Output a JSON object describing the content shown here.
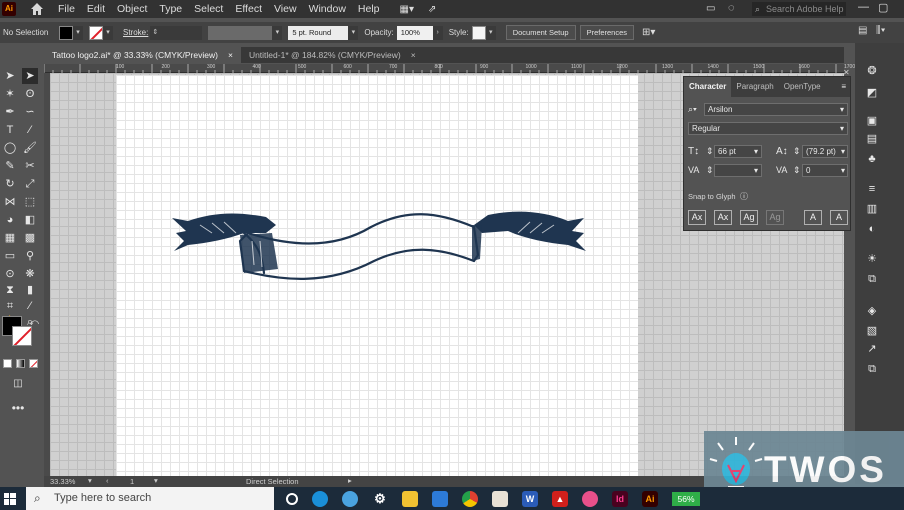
{
  "app": {
    "logo": "Ai",
    "menus": [
      "File",
      "Edit",
      "Object",
      "Type",
      "Select",
      "Effect",
      "View",
      "Window",
      "Help"
    ],
    "search_placeholder": "Search Adobe Help"
  },
  "control_bar": {
    "selection_label": "No Selection",
    "stroke_label": "Stroke:",
    "brush_value": "5 pt. Round",
    "opacity_label": "Opacity:",
    "opacity_value": "100%",
    "style_label": "Style:",
    "document_setup": "Document Setup",
    "preferences": "Preferences"
  },
  "document_tabs": [
    {
      "label": "Tattoo logo2.ai* @ 33.33% (CMYK/Preview)",
      "close": "×",
      "active": true
    },
    {
      "label": "Untitled-1* @ 184.82% (CMYK/Preview)",
      "close": "×",
      "active": false
    }
  ],
  "ruler_ticks": [
    "100",
    "200",
    "300",
    "400",
    "500",
    "600",
    "700",
    "800",
    "900",
    "1000",
    "1100",
    "1200",
    "1300",
    "1400",
    "1500",
    "1600",
    "1700"
  ],
  "status_bar": {
    "zoom": "33.33%",
    "artboard_number": "1",
    "tool_name": "Direct Selection"
  },
  "character_panel": {
    "tabs": [
      "Character",
      "Paragraph",
      "OpenType"
    ],
    "font_family": "Arsilon",
    "font_style": "Regular",
    "font_size": "66 pt",
    "leading": "(79.2 pt)",
    "tracking": "0",
    "snap_to_glyph": "Snap to Glyph",
    "glyph_buttons": [
      "Ax",
      "Ax",
      "Ag",
      "Ag",
      "A",
      "A"
    ]
  },
  "taskbar": {
    "search_placeholder": "Type here to search",
    "battery": "56%",
    "apps": [
      "Ai",
      "Id",
      "W"
    ]
  },
  "watermark": {
    "text": "TWOS"
  },
  "colors": {
    "ribbon": "#1f3550",
    "accent": "#ff9a00",
    "panel": "#535353"
  }
}
